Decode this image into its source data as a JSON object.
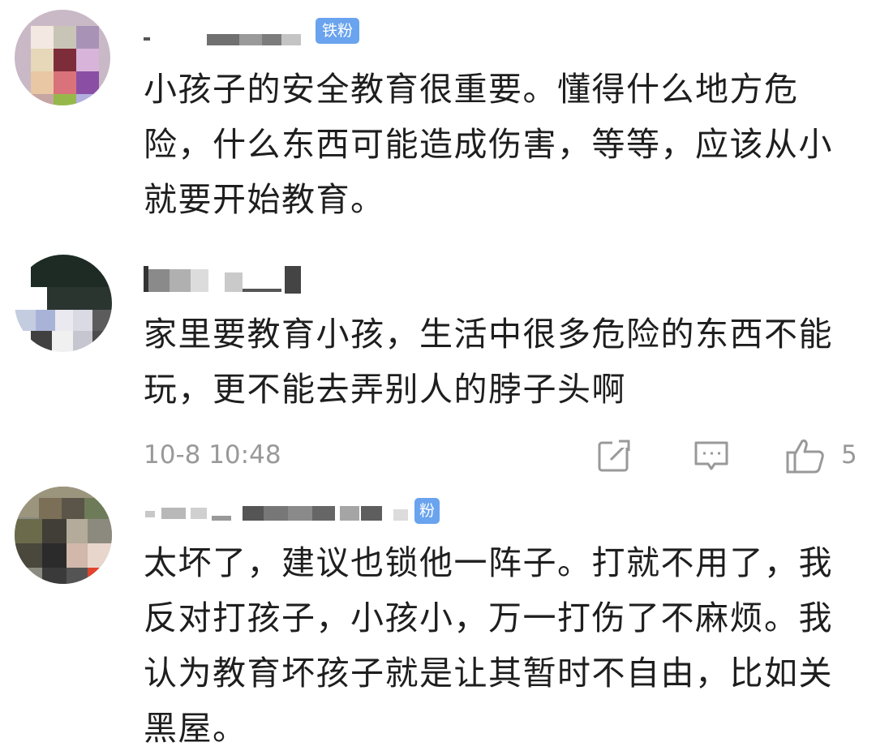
{
  "comments": [
    {
      "badge": "铁粉",
      "text": "小孩子的安全教育很重要。懂得什么地方危险，什么东西可能造成伤害，等等，应该从小就要开始教育。"
    },
    {
      "text": "家里要教育小孩，生活中很多危险的东西不能玩，更不能去弄别人的脖子头啊",
      "timestamp": "10-8 10:48",
      "like_count": "5",
      "icons": [
        "share-icon",
        "comment-icon",
        "like-icon"
      ]
    },
    {
      "badge": "粉",
      "text": "太坏了，建议也锁他一阵子。打就不用了，我反对打孩子，小孩小，万一打伤了不麻烦。我认为教育坏孩子就是让其暂时不自由，比如关黑屋。"
    }
  ],
  "colors": {
    "badge": "#6aa3ee",
    "meta_text": "#999999",
    "body_text": "#1e1e1e"
  }
}
